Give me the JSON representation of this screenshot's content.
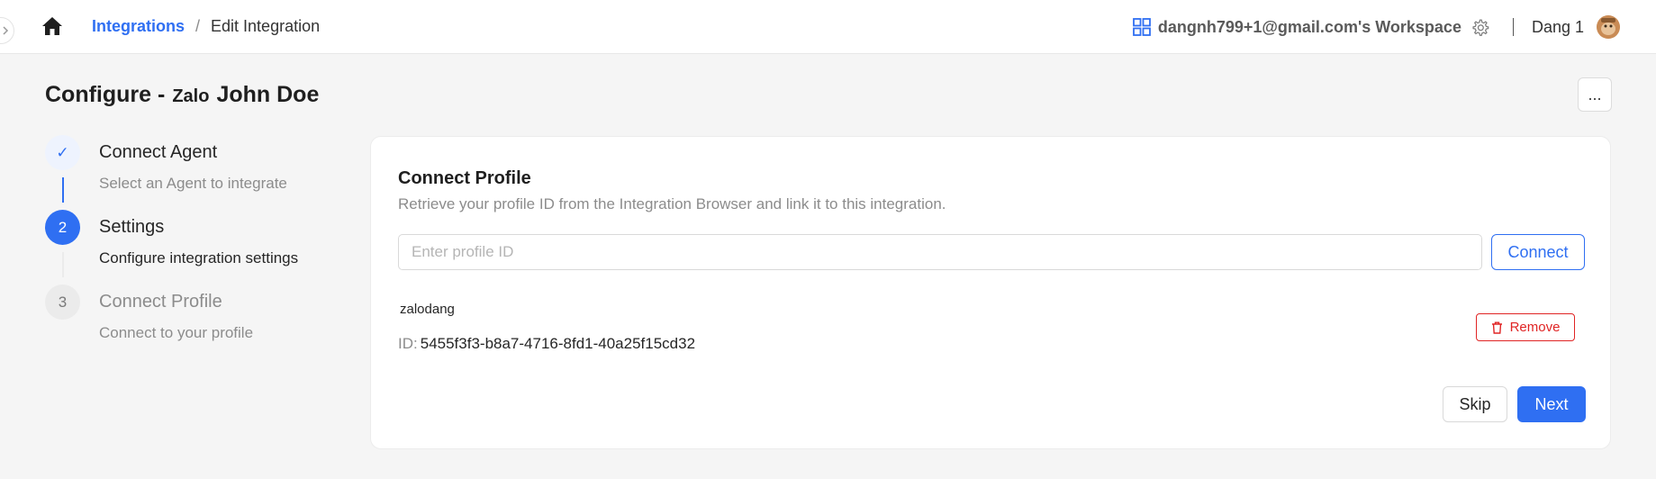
{
  "header": {
    "breadcrumb": {
      "link_label": "Integrations",
      "separator": "/",
      "current": "Edit Integration"
    },
    "workspace_name": "dangnh799+1@gmail.com's Workspace",
    "user_name": "Dang 1",
    "accent_color": "#2f6ff2"
  },
  "page": {
    "title_prefix": "Configure -",
    "title_channel": "Zalo",
    "title_name": "John Doe",
    "more_label": "..."
  },
  "steps": [
    {
      "marker": "✓",
      "title": "Connect Agent",
      "description": "Select an Agent to integrate",
      "status": "done"
    },
    {
      "marker": "2",
      "title": "Settings",
      "description": "Configure integration settings",
      "status": "active"
    },
    {
      "marker": "3",
      "title": "Connect Profile",
      "description": "Connect to your profile",
      "status": "wait"
    }
  ],
  "card": {
    "title": "Connect Profile",
    "subtitle": "Retrieve your profile ID from the Integration Browser and link it to this integration.",
    "input_placeholder": "Enter profile ID",
    "input_value": "",
    "connect_label": "Connect",
    "profile": {
      "name": "zalodang",
      "id_label": "ID:",
      "id_value": "5455f3f3-b8a7-4716-8fd1-40a25f15cd32",
      "remove_label": "Remove"
    },
    "skip_label": "Skip",
    "next_label": "Next"
  },
  "icons": {
    "home": "home-icon",
    "workspace": "grid-icon",
    "settings": "gear-icon",
    "remove": "trash-icon",
    "edge": "chevron-right-icon"
  },
  "colors": {
    "danger": "#e02424",
    "primary": "#2f6ff2"
  }
}
